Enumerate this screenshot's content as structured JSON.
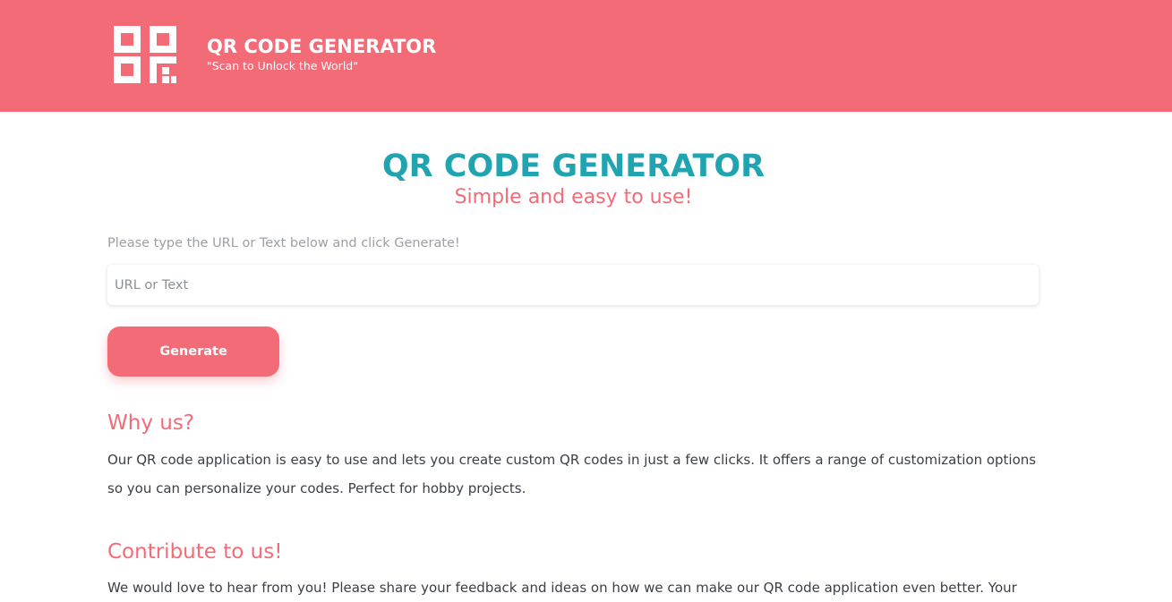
{
  "header": {
    "logo_icon": "qr-code-icon",
    "title": "QR CODE GENERATOR",
    "tagline": "\"Scan to Unlock the World\"",
    "background_color": "#f46b78"
  },
  "main": {
    "title": "QR CODE GENERATOR",
    "subtitle": "Simple and easy to use!",
    "instruction": "Please type the URL or Text below and click Generate!",
    "input": {
      "placeholder": "URL or Text",
      "value": ""
    },
    "generate_button": "Generate",
    "title_color": "#1fa4b0",
    "accent_color": "#f46b78"
  },
  "sections": [
    {
      "heading": "Why us?",
      "body": "Our QR code application is easy to use and lets you create custom QR codes in just a few clicks. It offers a range of customization options so you can personalize your codes. Perfect for hobby projects."
    },
    {
      "heading": "Contribute to us!",
      "body": "We would love to hear from you! Please share your feedback and ideas on how we can make our QR code application even better. Your"
    }
  ]
}
